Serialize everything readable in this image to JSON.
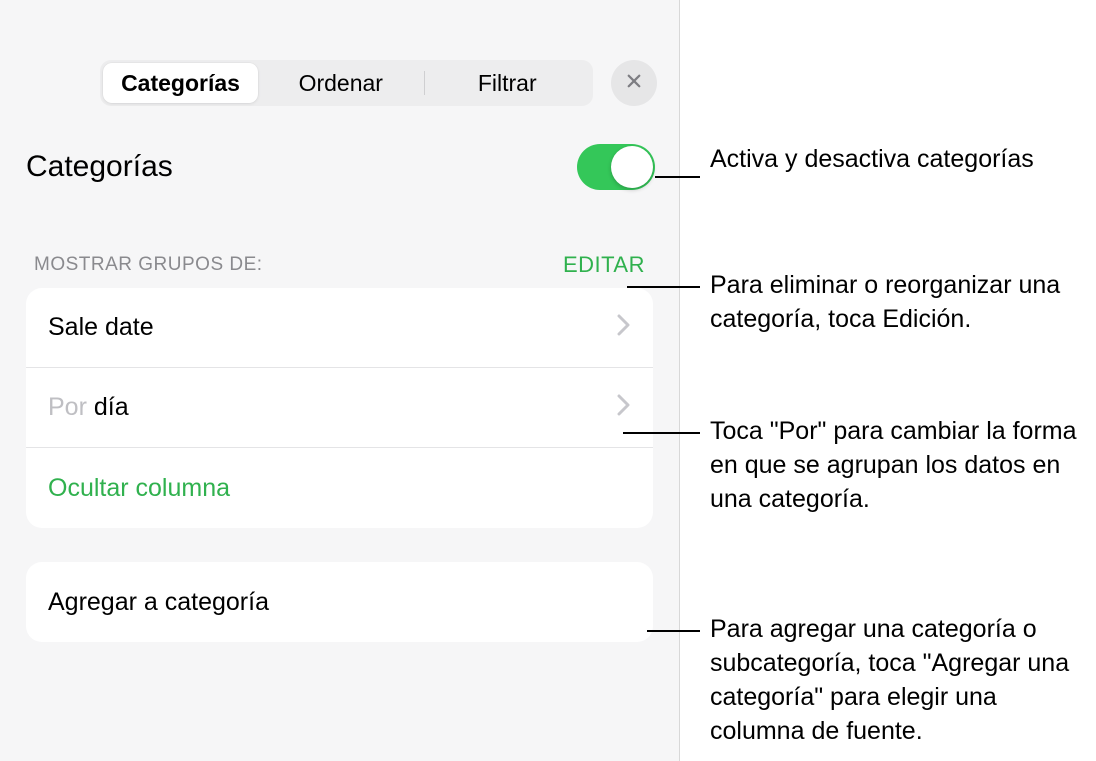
{
  "colors": {
    "accent_green": "#34c759",
    "link_green": "#30b14e"
  },
  "tabs": {
    "categories": "Categorías",
    "sort": "Ordenar",
    "filter": "Filtrar"
  },
  "close_icon": "close-icon",
  "title": "Categorías",
  "toggle_on": true,
  "section": {
    "label": "MOSTRAR GRUPOS DE:",
    "edit": "EDITAR"
  },
  "rows": {
    "sale_date": "Sale date",
    "by_prefix": "Por ",
    "by_value": "día",
    "hide_column": "Ocultar columna"
  },
  "add_category": "Agregar a categoría",
  "callouts": {
    "toggle": "Activa y desactiva categorías",
    "edit": "Para eliminar o reorganizar una categoría, toca Edición.",
    "por": "Toca \"Por\" para cambiar la forma en que se agrupan los datos en una categoría.",
    "add": "Para agregar una categoría o subcategoría, toca \"Agregar una categoría\" para elegir una columna de fuente."
  }
}
